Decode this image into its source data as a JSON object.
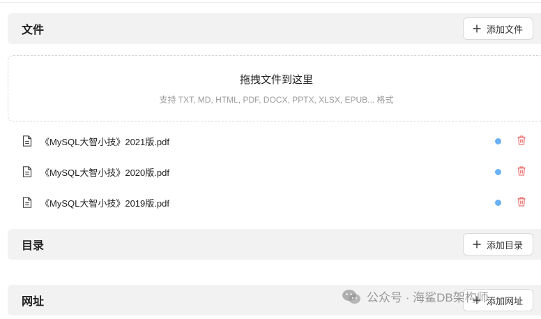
{
  "files_section": {
    "title": "文件",
    "add_label": "添加文件",
    "dropzone_title": "拖拽文件到这里",
    "dropzone_hint": "支持 TXT, MD, HTML, PDF, DOCX, PPTX, XLSX, EPUB... 格式",
    "files": [
      {
        "name": "《MySQL大智小技》2021版.pdf",
        "status_color": "#6ab1f7"
      },
      {
        "name": "《MySQL大智小技》2020版.pdf",
        "status_color": "#6ab1f7"
      },
      {
        "name": "《MySQL大智小技》2019版.pdf",
        "status_color": "#6ab1f7"
      }
    ]
  },
  "directory_section": {
    "title": "目录",
    "add_label": "添加目录"
  },
  "url_section": {
    "title": "网址",
    "add_label": "添加网址"
  },
  "watermark": {
    "text": "公众号 · 海鲨DB架构师"
  },
  "colors": {
    "header_bg": "#f2f2f2",
    "status_dot": "#6ab1f7",
    "delete_icon": "#e85a5a"
  }
}
